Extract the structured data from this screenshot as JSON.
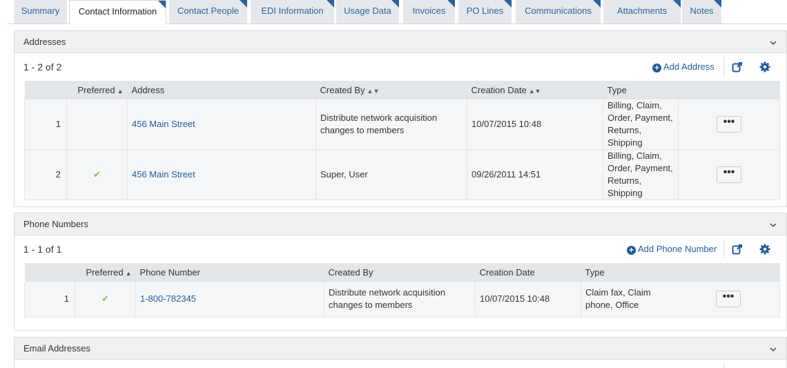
{
  "tabs": [
    {
      "label": "Summary",
      "active": false
    },
    {
      "label": "Contact Information",
      "active": true
    },
    {
      "label": "Contact People",
      "active": false
    },
    {
      "label": "EDI Information",
      "active": false
    },
    {
      "label": "Usage Data",
      "active": false
    },
    {
      "label": "Invoices",
      "active": false
    },
    {
      "label": "PO Lines",
      "active": false
    },
    {
      "label": "Communications",
      "active": false
    },
    {
      "label": "Attachments",
      "active": false
    },
    {
      "label": "Notes",
      "active": false
    }
  ],
  "icons": {
    "collapse": "chevron-down-icon",
    "add": "plus-circle-icon",
    "export": "external-link-icon",
    "settings": "gear-icon",
    "preferred": "check-icon",
    "sort": "sort-icon",
    "row_actions": "ellipsis-icon"
  },
  "colors": {
    "link": "#1f5c99",
    "check": "#7cc442",
    "header_bg": "#eef0f2",
    "tab_bg": "#e4e8ec"
  },
  "addresses": {
    "title": "Addresses",
    "count": "1 - 2 of 2",
    "add_label": "Add Address",
    "columns": {
      "preferred": "Preferred",
      "preferred_sort": "▲",
      "address": "Address",
      "created_by": "Created By",
      "created_by_sort": "▲▼",
      "creation_date": "Creation Date",
      "creation_date_sort": "▲▼",
      "type": "Type"
    },
    "rows": [
      {
        "index": "1",
        "preferred": "",
        "address": "456 Main Street",
        "created_by": "Distribute network acquisition changes to members",
        "creation_date": "10/07/2015 10:48",
        "type": "Billing, Claim, Order, Payment, Returns, Shipping",
        "actions": "•••"
      },
      {
        "index": "2",
        "preferred": "✔",
        "address": "456 Main Street",
        "created_by": "Super, User",
        "creation_date": "09/26/2011 14:51",
        "type": "Billing, Claim, Order, Payment, Returns, Shipping",
        "actions": "•••"
      }
    ]
  },
  "phones": {
    "title": "Phone Numbers",
    "count": "1 - 1 of 1",
    "add_label": "Add Phone Number",
    "columns": {
      "preferred": "Preferred",
      "preferred_sort": "▲",
      "phone_number": "Phone Number",
      "created_by": "Created By",
      "creation_date": "Creation Date",
      "type": "Type"
    },
    "rows": [
      {
        "index": "1",
        "preferred": "✔",
        "phone_number": "1-800-782345",
        "created_by": "Distribute network acquisition changes to members",
        "creation_date": "10/07/2015 10:48",
        "type": "Claim fax, Claim phone, Office",
        "actions": "•••"
      }
    ]
  },
  "emails": {
    "title": "Email Addresses"
  }
}
